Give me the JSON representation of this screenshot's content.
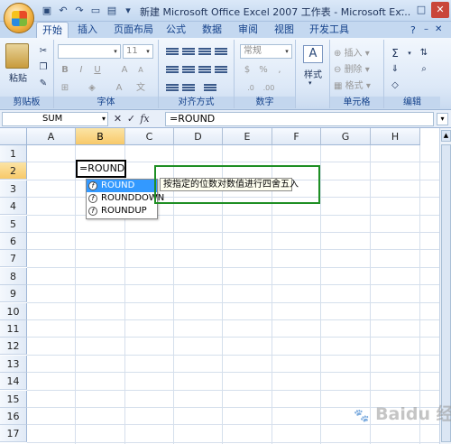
{
  "window": {
    "title": "新建 Microsoft Office Excel 2007 工作表 - Microsoft Ex..."
  },
  "tabs": [
    {
      "label": "开始",
      "active": true
    },
    {
      "label": "插入"
    },
    {
      "label": "页面布局"
    },
    {
      "label": "公式"
    },
    {
      "label": "数据"
    },
    {
      "label": "审阅"
    },
    {
      "label": "视图"
    },
    {
      "label": "开发工具"
    }
  ],
  "ribbon": {
    "clipboard": {
      "label": "剪贴板",
      "paste_label": "粘贴"
    },
    "font": {
      "label": "字体",
      "size_value": "11"
    },
    "alignment": {
      "label": "对齐方式"
    },
    "number": {
      "label": "数字",
      "format_value": "常规"
    },
    "styles": {
      "label": "样式"
    },
    "cells": {
      "label": "单元格",
      "insert_label": "插入",
      "delete_label": "删除",
      "format_label": "格式"
    },
    "editing": {
      "label": "编辑"
    }
  },
  "formula_bar": {
    "name_box": "SUM",
    "formula": "=ROUND"
  },
  "sheet": {
    "columns": [
      "A",
      "B",
      "C",
      "D",
      "E",
      "F",
      "G",
      "H"
    ],
    "rows": [
      "1",
      "2",
      "3",
      "4",
      "5",
      "6",
      "7",
      "8",
      "9",
      "10",
      "11",
      "12",
      "13",
      "14",
      "15",
      "16",
      "17"
    ],
    "selected_column": "B",
    "selected_row": "2",
    "active_cell_text": "=ROUND"
  },
  "autocomplete": {
    "items": [
      "ROUND",
      "ROUNDDOWN",
      "ROUNDUP"
    ],
    "selected_index": 0,
    "tooltip": "按指定的位数对数值进行四舍五入"
  },
  "watermark": "Baidu 经验",
  "colors": {
    "selection": "#3399ff",
    "annotation": "#1f8f24",
    "header_highlight": "#f8c969"
  }
}
